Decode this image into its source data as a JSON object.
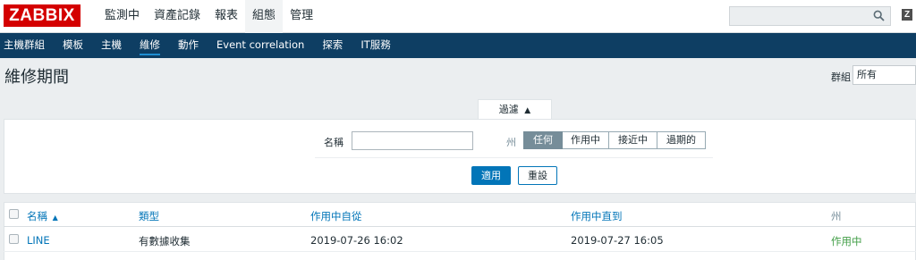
{
  "app": {
    "logo": "ZABBIX"
  },
  "main_menu": [
    "監測中",
    "資產記錄",
    "報表",
    "組態",
    "管理"
  ],
  "sub_menu": [
    "主機群組",
    "模板",
    "主機",
    "維修",
    "動作",
    "Event correlation",
    "探索",
    "IT服務"
  ],
  "page": {
    "title": "維修期間",
    "group_label": "群組",
    "group_value": "所有"
  },
  "search": {
    "placeholder": ""
  },
  "filter": {
    "tab_label": "過濾",
    "tab_arrow": "▲",
    "name_label": "名稱",
    "name_value": "",
    "state_label": "州",
    "state_options": [
      "任何",
      "作用中",
      "接近中",
      "過期的"
    ],
    "state_selected": "任何",
    "apply_label": "適用",
    "reset_label": "重設"
  },
  "table": {
    "columns": [
      "名稱",
      "類型",
      "作用中自從",
      "作用中直到",
      "州"
    ],
    "sort_arrow": "▲",
    "rows": [
      {
        "name": "LINE",
        "type": "有數據收集",
        "active_since": "2019-07-26 16:02",
        "active_till": "2019-07-27 16:05",
        "state": "作用中"
      }
    ]
  },
  "colors": {
    "brand": "#d40000",
    "nav": "#0e3e63",
    "link": "#0275b8",
    "active_state": "#429e47"
  }
}
